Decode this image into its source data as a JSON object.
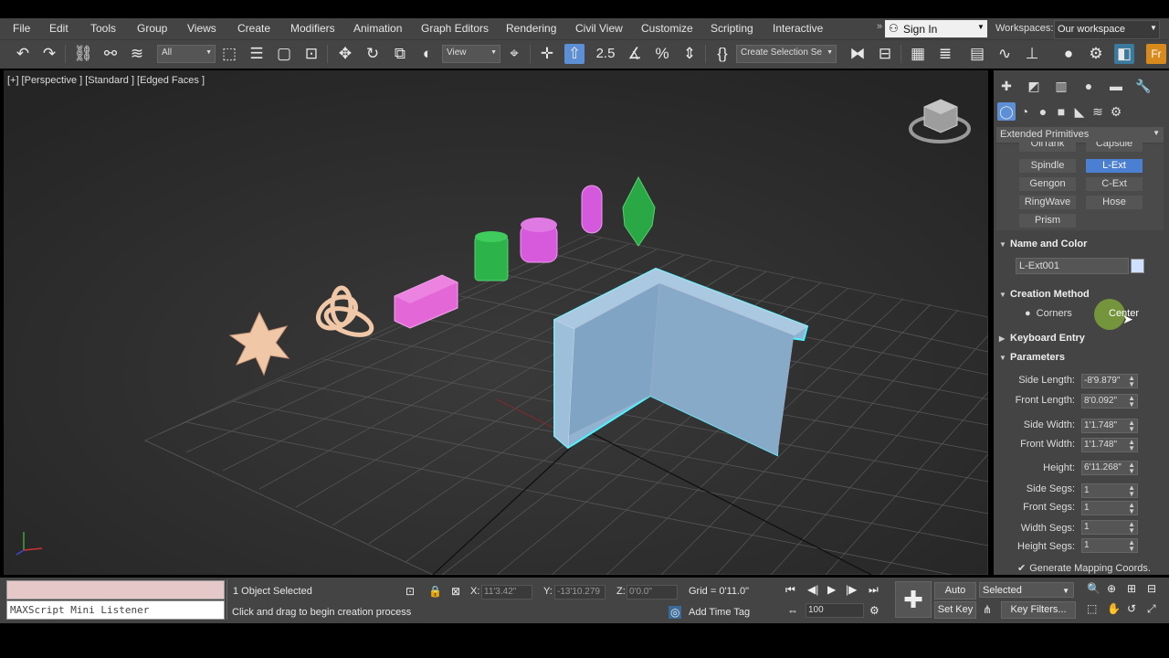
{
  "menu": {
    "items": [
      "File",
      "Edit",
      "Tools",
      "Group",
      "Views",
      "Create",
      "Modifiers",
      "Animation",
      "Graph Editors",
      "Rendering",
      "Civil View",
      "Customize",
      "Scripting",
      "Interactive"
    ],
    "sign_in": "Sign In",
    "workspaces_label": "Workspaces:",
    "workspace_value": "Our workspace"
  },
  "toolbar": {
    "filter_value": "All",
    "ref_coord_value": "View",
    "selection_set_placeholder": "Create Selection Se",
    "snap_label": "2.5"
  },
  "viewport": {
    "label_parts": [
      "[+]",
      "[Perspective ]",
      "[Standard ]",
      "[Edged Faces ]"
    ]
  },
  "command_panel": {
    "category": "Extended Primitives",
    "object_types": [
      {
        "label": "OilTank",
        "selected": false
      },
      {
        "label": "Capsule",
        "selected": false
      },
      {
        "label": "Spindle",
        "selected": false
      },
      {
        "label": "L-Ext",
        "selected": true
      },
      {
        "label": "Gengon",
        "selected": false
      },
      {
        "label": "C-Ext",
        "selected": false
      },
      {
        "label": "RingWave",
        "selected": false
      },
      {
        "label": "Hose",
        "selected": false
      },
      {
        "label": "Prism",
        "selected": false
      }
    ],
    "name_and_color": {
      "title": "Name and Color",
      "name_value": "L-Ext001",
      "color": "#cfe0ff"
    },
    "creation_method": {
      "title": "Creation Method",
      "option1": "Corners",
      "option2": "Center"
    },
    "keyboard_entry": {
      "title": "Keyboard Entry"
    },
    "parameters": {
      "title": "Parameters",
      "rows": [
        {
          "label": "Side Length:",
          "value": "-8'9.879\""
        },
        {
          "label": "Front Length:",
          "value": "8'0.092\""
        },
        {
          "label": "Side Width:",
          "value": "1'1.748\""
        },
        {
          "label": "Front Width:",
          "value": "1'1.748\""
        },
        {
          "label": "Height:",
          "value": "6'11.268\""
        },
        {
          "label": "Side Segs:",
          "value": "1"
        },
        {
          "label": "Front Segs:",
          "value": "1"
        },
        {
          "label": "Width Segs:",
          "value": "1"
        },
        {
          "label": "Height Segs:",
          "value": "1"
        }
      ],
      "mapping_checkbox": "Generate Mapping Coords."
    }
  },
  "status": {
    "listener": "MAXScript Mini Listener",
    "selection": "1 Object Selected",
    "prompt": "Click and drag to begin creation process",
    "x_label": "X:",
    "x_value": "11'3.42\"",
    "y_label": "Y:",
    "y_value": "-13'10.279",
    "z_label": "Z:",
    "z_value": "0'0.0\"",
    "grid": "Grid = 0'11.0\"",
    "add_time_tag": "Add Time Tag",
    "frame": "100",
    "auto_key": "Auto Key",
    "set_key": "Set Key",
    "key_mode": "Selected",
    "key_filters": "Key Filters..."
  }
}
